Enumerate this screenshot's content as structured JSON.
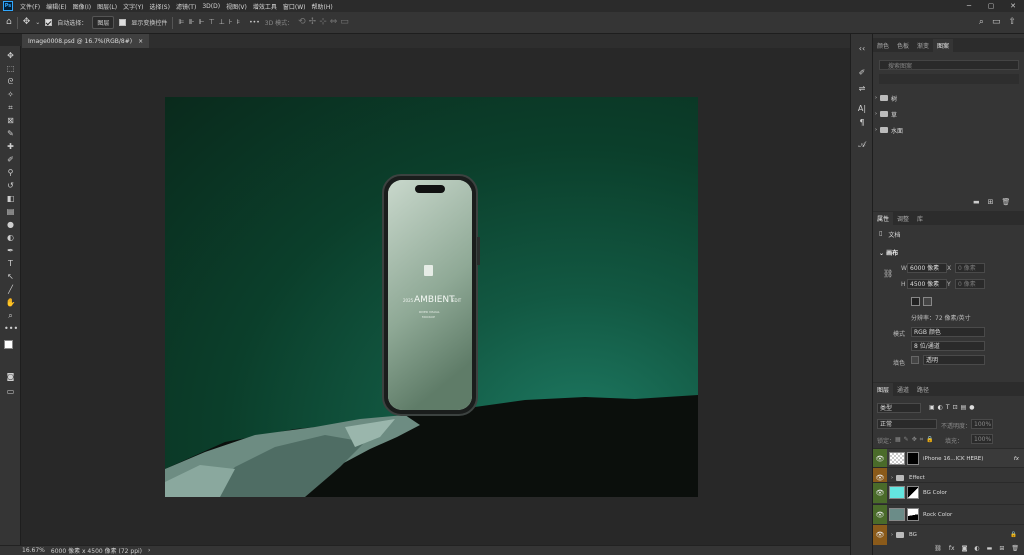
{
  "menubar": {
    "logo": "Ps",
    "items": [
      "文件(F)",
      "编辑(E)",
      "图像(I)",
      "图层(L)",
      "文字(Y)",
      "选择(S)",
      "滤镜(T)",
      "3D(D)",
      "视图(V)",
      "增效工具",
      "窗口(W)",
      "帮助(H)"
    ],
    "window_controls": [
      "─",
      "▢",
      "✕"
    ]
  },
  "options": {
    "auto_select_label": "自动选择：",
    "auto_select_value": "图层",
    "show_transform_label": "显示变换控件",
    "more": "•••",
    "mode_3d_label": "3D 模式："
  },
  "document_tab": {
    "title": "Image0008.psd @ 16.7%(RGB/8#)",
    "close": "×"
  },
  "status": {
    "zoom": "16.67%",
    "size": "6000 像素 x 4500 像素 (72 ppi)",
    "arrow": "›"
  },
  "mockup": {
    "year": "2025",
    "brand": "AMBIENT",
    "edit": "EDIT",
    "sub1": "RIVER VISUAL",
    "sub2": "MOCKUP"
  },
  "libraries_panel": {
    "tabs": [
      "颜色",
      "色板",
      "渐变",
      "图案"
    ],
    "search_placeholder": "搜索图案",
    "folders": [
      "树",
      "草",
      "水面"
    ]
  },
  "properties_panel": {
    "tabs": [
      "属性",
      "调整",
      "库"
    ],
    "doc_label": "文档",
    "section": "画布",
    "w_label": "W",
    "w_value": "6000 像素",
    "x_label": "X",
    "x_placeholder": "0 像素",
    "h_label": "H",
    "h_value": "4500 像素",
    "y_label": "Y",
    "y_placeholder": "0 像素",
    "resolution": "分辨率：72 像素/英寸",
    "mode_label": "模式",
    "mode_value": "RGB 颜色",
    "depth_value": "8 位/通道",
    "fill_label": "填色",
    "fill_value": "透明"
  },
  "layers_panel": {
    "tabs": [
      "图层",
      "通道",
      "路径"
    ],
    "filter_value": "类型",
    "blend_mode": "正常",
    "opacity_label": "不透明度：",
    "opacity_value": "100%",
    "lock_label": "锁定：",
    "fill_label": "填充：",
    "fill_value": "100%",
    "layers": [
      {
        "name": "iPhone 16...ICK HERE)",
        "fx": "fx",
        "type": "smart"
      },
      {
        "name": "Effect",
        "type": "group"
      },
      {
        "name": "BG Color",
        "type": "fill",
        "color": "#64e6e0"
      },
      {
        "name": "Rock Color",
        "type": "fill",
        "color": "#6b8c88"
      },
      {
        "name": "BG",
        "type": "group"
      }
    ]
  },
  "colors": {
    "accent_eye": "#4a6b2a",
    "accent_eye_orange": "#8a5a1a",
    "bg_green": "#0b3f2b"
  }
}
